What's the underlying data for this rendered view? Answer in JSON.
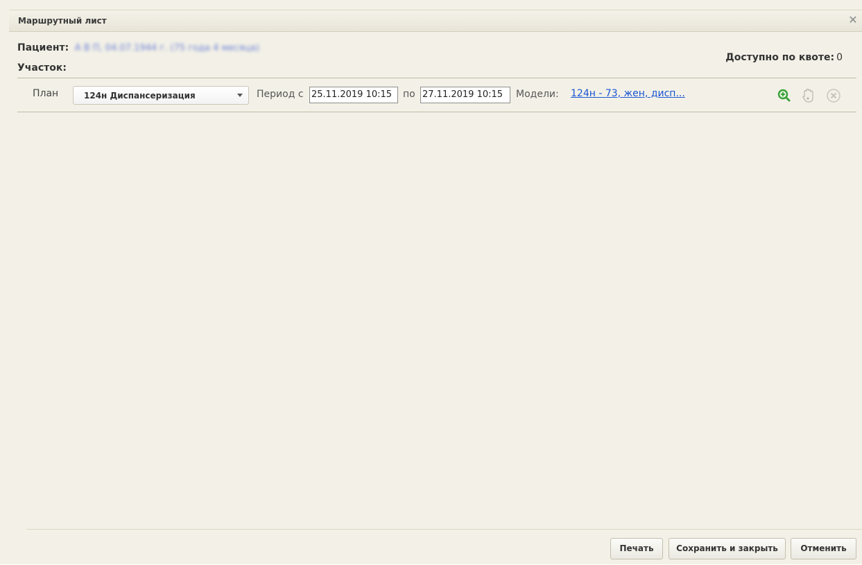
{
  "dialog": {
    "title": "Маршрутный лист",
    "close_icon": "close-icon"
  },
  "patient": {
    "label": "Пациент:",
    "value": "А В П, 04.07.1944 г. (75 года 4 месяца)",
    "uchastok_label": "Участок:"
  },
  "quota": {
    "label": "Доступно по квоте:",
    "value": "0"
  },
  "toolbar": {
    "plan_label": "План",
    "plan_selected": "124н Диспансеризация",
    "period_label": "Период с",
    "date_from": "25.11.2019 10:15",
    "to_label": "по",
    "date_to": "27.11.2019 10:15",
    "models_label": "Модели:",
    "models_link": "124н - 73, жен, дисп...",
    "icons": [
      "zoom-in-icon",
      "hand-icon",
      "remove-icon"
    ]
  },
  "footer": {
    "print_label": "Печать",
    "save_close_label": "Сохранить и закрыть",
    "cancel_label": "Отменить"
  },
  "colors": {
    "background": "#f3f1e7",
    "link": "#1a55d4",
    "zoom_icon": "#3aa13a"
  }
}
